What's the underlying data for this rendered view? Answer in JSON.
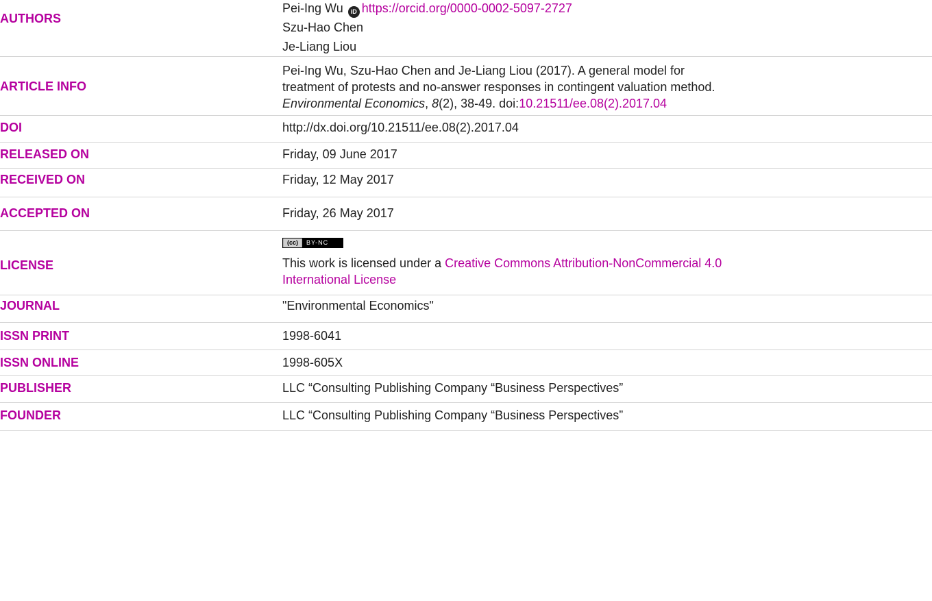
{
  "authors": {
    "label": "AUTHORS",
    "list": [
      {
        "name": "Pei-Ing Wu",
        "orcid_badge": "iD",
        "orcid_url": "https://orcid.org/0000-0002-5097-2727"
      },
      {
        "name": "Szu-Hao Chen"
      },
      {
        "name": "Je-Liang Liou"
      }
    ]
  },
  "article_info": {
    "label": "ARTICLE INFO",
    "citation_line1": "Pei-Ing Wu, Szu-Hao Chen and Je-Liang Liou (2017). A general model for",
    "citation_line2": "treatment of protests and no-answer responses in contingent valuation method.",
    "journal_italic": "Environmental Economics",
    "sep1": ", ",
    "volume_italic": "8",
    "issue_pages": "(2), 38-49. doi:",
    "doi_link": "10.21511/ee.08(2).2017.04"
  },
  "doi": {
    "label": "DOI",
    "value": "http://dx.doi.org/10.21511/ee.08(2).2017.04"
  },
  "released": {
    "label": "RELEASED ON",
    "value": "Friday, 09 June 2017"
  },
  "received": {
    "label": "RECEIVED ON",
    "value": "Friday, 12 May 2017"
  },
  "accepted": {
    "label": "ACCEPTED ON",
    "value": "Friday, 26 May 2017"
  },
  "license": {
    "label": "LICENSE",
    "badge_cc": "(cc)",
    "badge_by": "BY-NC",
    "text_prefix": "This work is licensed under a ",
    "link_line1": "Creative Commons Attribution-NonCommercial 4.0",
    "link_line2": "International License"
  },
  "journal": {
    "label": "JOURNAL",
    "value": "\"Environmental Economics\""
  },
  "issn_print": {
    "label": "ISSN PRINT",
    "value": "1998-6041"
  },
  "issn_online": {
    "label": "ISSN ONLINE",
    "value": "1998-605X"
  },
  "publisher": {
    "label": "PUBLISHER",
    "value": "LLC “Consulting Publishing Company “Business Perspectives”"
  },
  "founder": {
    "label": "FOUNDER",
    "value": "LLC “Consulting Publishing Company “Business Perspectives”"
  },
  "colors": {
    "label": "#b5009e",
    "text": "#222222",
    "divider": "#d4d4d4"
  }
}
